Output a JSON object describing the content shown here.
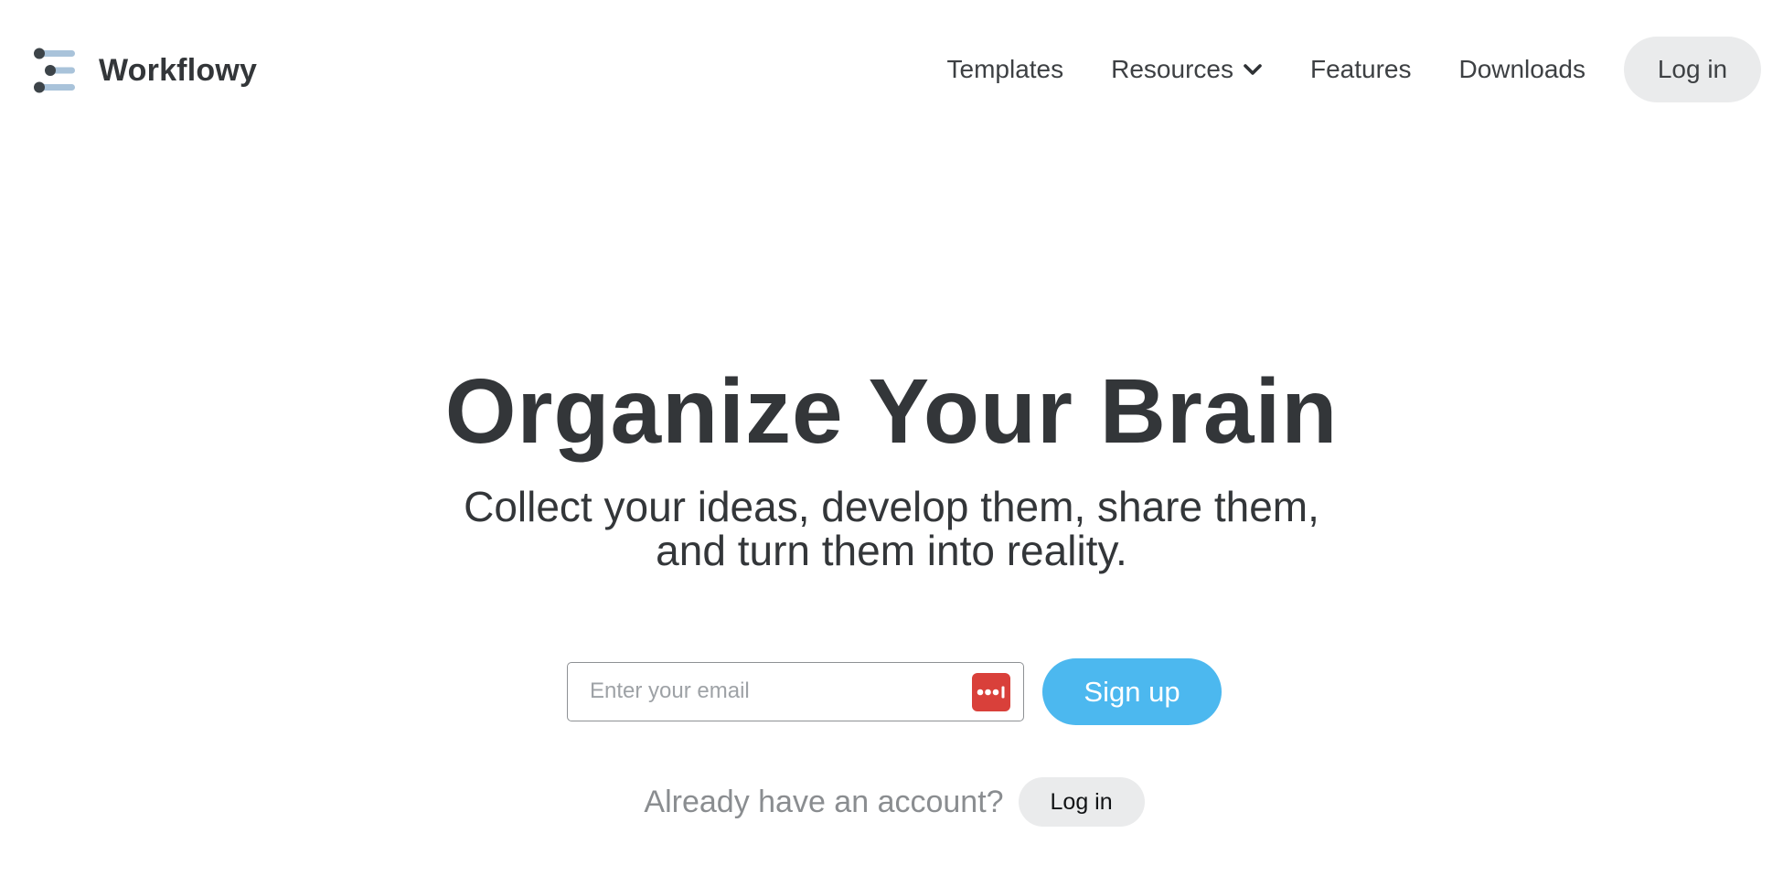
{
  "brand": {
    "name": "Workflowy",
    "logo_icon": "workflowy-bullets-icon",
    "logo_colors": [
      "#3d4449",
      "#a9c3da"
    ]
  },
  "nav": {
    "items": [
      {
        "label": "Templates"
      },
      {
        "label": "Resources",
        "icon": "chevron-down-icon"
      },
      {
        "label": "Features"
      },
      {
        "label": "Downloads"
      }
    ],
    "login_label": "Log in"
  },
  "hero": {
    "title": "Organize Your Brain",
    "subtitle": "Collect your ideas, develop them, share them, and turn them into reality."
  },
  "signup": {
    "email_placeholder": "Enter your email",
    "email_value": "",
    "password_manager_icon": "password-manager-icon",
    "button_label": "Sign up",
    "accent_color": "#4cb8ef"
  },
  "account": {
    "prompt": "Already have an account?",
    "login_label": "Log in"
  }
}
